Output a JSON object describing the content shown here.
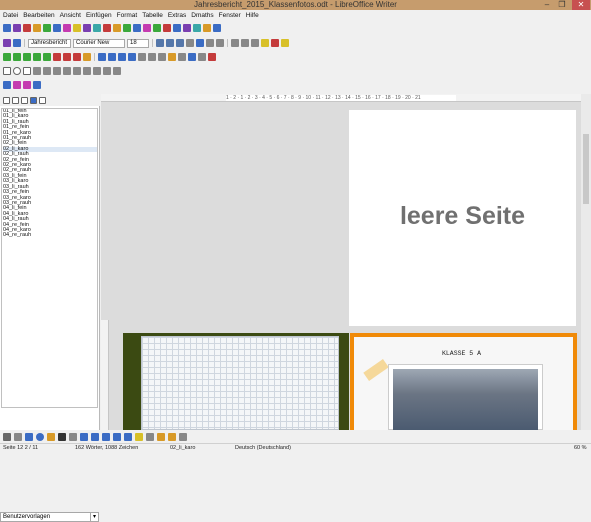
{
  "window": {
    "title": "Jahresbericht_2015_Klassenfotos.odt - LibreOffice Writer",
    "minimize": "–",
    "maximize": "❐",
    "close": "✕"
  },
  "menu": [
    "Datei",
    "Bearbeiten",
    "Ansicht",
    "Einfügen",
    "Format",
    "Tabelle",
    "Extras",
    "Dmaths",
    "Fenster",
    "Hilfe"
  ],
  "format_bar": {
    "paragraph_style": "Jahresbericht",
    "font_name": "Courier New",
    "font_size": "18"
  },
  "navigator": {
    "items": [
      "01_li_fein",
      "01_li_karo",
      "01_li_rauh",
      "01_re_fein",
      "01_re_karo",
      "01_re_rauh",
      "02_li_fein",
      "02_li_karo",
      "02_li_rauh",
      "02_re_fein",
      "02_re_karo",
      "02_re_rauh",
      "03_li_fein",
      "03_li_karo",
      "03_li_rauh",
      "03_re_fein",
      "03_re_karo",
      "03_re_rauh",
      "04_li_fein",
      "04_li_karo",
      "04_li_rauh",
      "04_re_fein",
      "04_re_karo",
      "04_re_rauh"
    ],
    "selected_index": 7,
    "style_dropdown": "Benutzervorlagen"
  },
  "ruler_text": "1 · 2 · 1 · 2 · 3 · 4 · 5 · 6 · 7 · 8 · 9 · 10 · 11 · 12 · 13 · 14 · 15 · 16 · 17 · 18 · 19 · 20 · 21",
  "pages": {
    "page1_text": "leere Seite",
    "class_label": "KLASSE 5 A"
  },
  "status": {
    "page": "Seite 12  2 / 11",
    "words": "162 Wörter, 1088 Zeichen",
    "style": "02_li_karo",
    "language": "Deutsch (Deutschland)",
    "zoom": "60 %"
  }
}
